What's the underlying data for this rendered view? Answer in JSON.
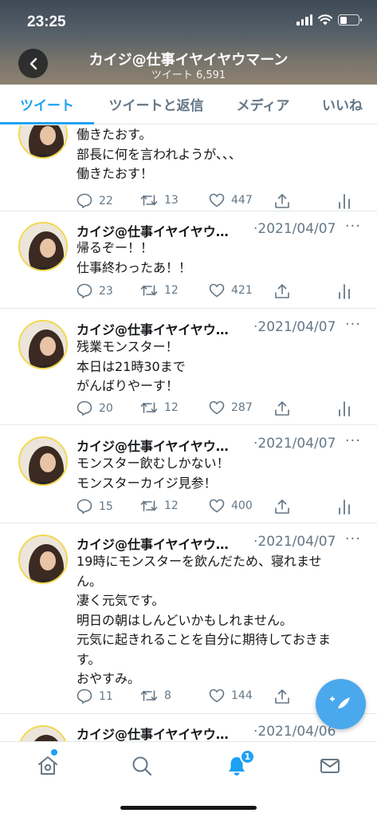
{
  "status": {
    "time": "23:25"
  },
  "header": {
    "profile_name": "カイジ@仕事イヤイヤウマーン",
    "tweet_count": "ツイート 6,591"
  },
  "tabs": [
    {
      "label": "ツイート",
      "active": true
    },
    {
      "label": "ツイートと返信",
      "active": false
    },
    {
      "label": "メディア",
      "active": false
    },
    {
      "label": "いいね",
      "active": false
    }
  ],
  "tweets": [
    {
      "name": "",
      "date": "",
      "lines": [
        "働きたおす。",
        "部長に何を言われようが、、、",
        "働きたおす！"
      ],
      "replies": "22",
      "retweets": "13",
      "likes": "447"
    },
    {
      "name": "カイジ@仕事イヤイヤウ…",
      "date": "·2021/04/07",
      "lines": [
        "帰るぞー！！",
        "仕事終わったあ！！"
      ],
      "replies": "23",
      "retweets": "12",
      "likes": "421"
    },
    {
      "name": "カイジ@仕事イヤイヤウ…",
      "date": "·2021/04/07",
      "lines": [
        "残業モンスター！",
        "本日は21時30まで",
        "がんばりやーす！"
      ],
      "replies": "20",
      "retweets": "12",
      "likes": "287"
    },
    {
      "name": "カイジ@仕事イヤイヤウ…",
      "date": "·2021/04/07",
      "lines": [
        "モンスター飲むしかない！",
        "モンスターカイジ見参！"
      ],
      "replies": "15",
      "retweets": "12",
      "likes": "400"
    },
    {
      "name": "カイジ@仕事イヤイヤウ…",
      "date": "·2021/04/07",
      "lines": [
        "19時にモンスターを飲んだため、寝れませ",
        "ん。",
        "凄く元気です。",
        "明日の朝はしんどいかもしれません。",
        "元気に起きれることを自分に期待しておきま",
        "す。",
        "おやすみ。"
      ],
      "replies": "11",
      "retweets": "8",
      "likes": "144"
    },
    {
      "name": "カイジ@仕事イヤイヤウ…",
      "date": "·2021/04/06",
      "lines": [],
      "replies": "",
      "retweets": "",
      "likes": ""
    }
  ],
  "more_label": "···",
  "nav": {
    "notification_count": "1"
  },
  "icons": {
    "back": "back-arrow-icon",
    "reply": "reply-icon",
    "retweet": "retweet-icon",
    "like": "heart-icon",
    "share": "share-icon",
    "analytics": "analytics-icon",
    "compose": "compose-icon",
    "home": "home-icon",
    "search": "search-icon",
    "notifications": "bell-icon",
    "messages": "mail-icon"
  },
  "colors": {
    "accent": "#1da1f2",
    "muted": "#657786",
    "divider": "#e1e8ed",
    "avatar_ring": "#f2d84f"
  }
}
